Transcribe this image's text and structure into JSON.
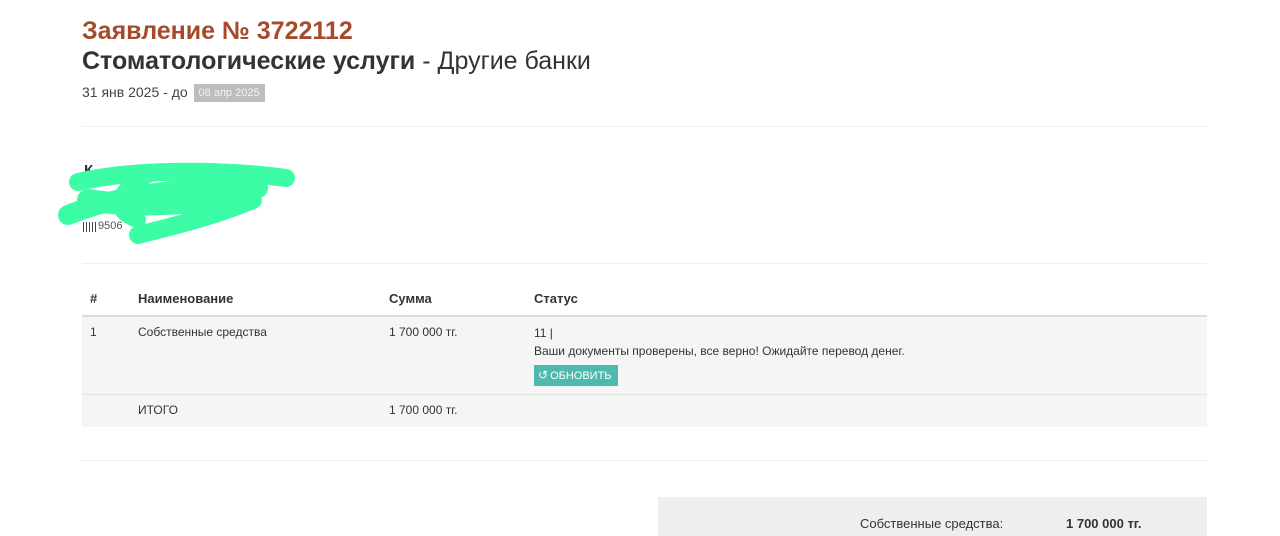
{
  "application": {
    "title": "Заявление № 3722112",
    "service": "Стоматологические услуги",
    "separator": " - ",
    "bank": "Другие банки",
    "date_prefix": "31 янв 2025 - до",
    "date_until": "08 апр 2025"
  },
  "client": {
    "initial": "К",
    "id_partial": "9506"
  },
  "table": {
    "headers": [
      "#",
      "Наименование",
      "Сумма",
      "Статус"
    ],
    "rows": [
      {
        "num": "1",
        "name": "Собственные средства",
        "sum": "1 700 000 тг.",
        "status_code": "11 |",
        "status_message": "Ваши документы проверены, все верно! Ожидайте перевод денег.",
        "refresh_label": "ОБНОВИТЬ"
      }
    ],
    "total": {
      "label": "ИТОГО",
      "sum": "1 700 000 тг."
    }
  },
  "summary": {
    "label": "Собственные средства:",
    "value": "1 700 000 тг."
  },
  "colors": {
    "title": "#a64b2a",
    "button": "#4fb9ad",
    "redaction": "#3dfca6"
  },
  "icons": {
    "refresh": "refresh-icon",
    "barcode": "barcode-icon"
  }
}
